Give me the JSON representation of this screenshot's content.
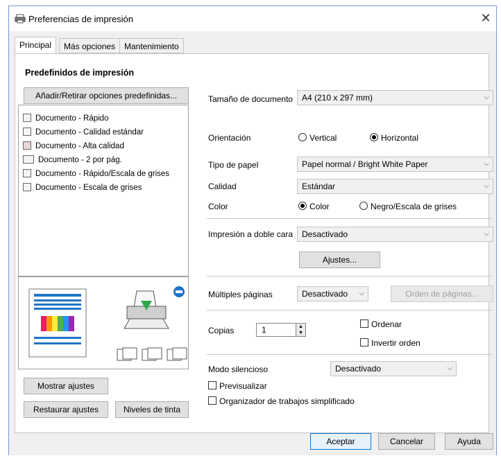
{
  "window": {
    "title": "Preferencias de impresión"
  },
  "tabs": [
    "Principal",
    "Más opciones",
    "Mantenimiento"
  ],
  "presets": {
    "heading": "Predefinidos de impresión",
    "add_remove_button": "Añadir/Retirar opciones predefinidas...",
    "items": [
      "Documento - Rápido",
      "Documento - Calidad estándar",
      "Documento - Alta calidad",
      "Documento - 2 por pág.",
      "Documento - Rápido/Escala de grises",
      "Documento - Escala de grises"
    ]
  },
  "left_buttons": {
    "show_settings": "Mostrar ajustes",
    "restore_settings": "Restaurar ajustes",
    "ink_levels": "Niveles de tinta"
  },
  "settings": {
    "document_size": {
      "label": "Tamaño de documento",
      "value": "A4 (210 x 297 mm)"
    },
    "orientation": {
      "label": "Orientación",
      "vertical": "Vertical",
      "horizontal": "Horizontal"
    },
    "paper_type": {
      "label": "Tipo de papel",
      "value": "Papel normal / Bright White Paper"
    },
    "quality": {
      "label": "Calidad",
      "value": "Estándar"
    },
    "color": {
      "label": "Color",
      "color": "Color",
      "grayscale": "Negro/Escala de grises"
    },
    "duplex": {
      "label": "Impresión a doble cara",
      "value": "Desactivado",
      "settings_button": "Ajustes..."
    },
    "multiple_pages": {
      "label": "Múltiples páginas",
      "value": "Desactivado",
      "order_button": "Orden de páginas..."
    },
    "copies": {
      "label": "Copias",
      "value": "1",
      "collate": "Ordenar",
      "reverse": "Invertir orden"
    },
    "quiet_mode": {
      "label": "Modo silencioso",
      "value": "Desactivado"
    },
    "preview": "Previsualizar",
    "job_arranger": "Organizador de trabajos simplificado"
  },
  "footer": {
    "ok": "Aceptar",
    "cancel": "Cancelar",
    "help": "Ayuda"
  }
}
